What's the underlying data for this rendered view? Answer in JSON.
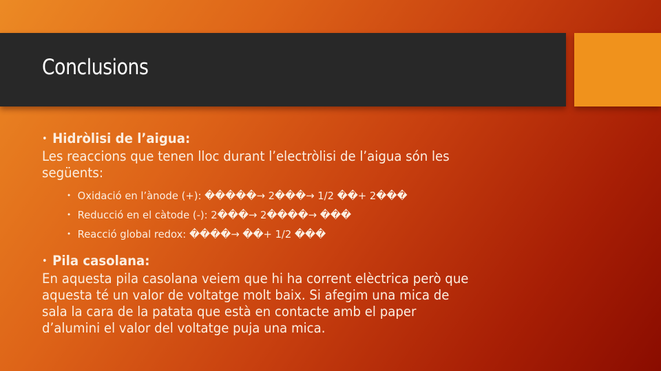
{
  "slide": {
    "title": "Conclusions",
    "colors": {
      "title_bar": "#282828",
      "accent_box": "#f0921c",
      "background_start": "#ec8a24",
      "background_end": "#8a0c00",
      "text": "#fbeee0"
    },
    "sections": [
      {
        "heading": "Hidròlisi de l’aigua:",
        "body_lines": [
          "Les reaccions que tenen lloc durant l’electròlisi de l’aigua són les",
          "següents:"
        ],
        "sub_bullets": [
          "Oxidació en l’ànode (+): �����→ 2���→ 1/2  ��+ 2���",
          "Reducció en el càtode (-): 2���→ 2����→ ���",
          "Reacció global redox: ����→ ��+ 1/2 ���"
        ]
      },
      {
        "heading": "Pila casolana:",
        "body_lines": [
          "En aquesta pila casolana veiem que hi ha corrent elèctrica però que",
          "aquesta té un valor de voltatge molt baix. Si afegim una mica de",
          "sala la cara de la patata que està en contacte amb el paper",
          "d’alumini el valor del voltatge puja una mica."
        ]
      }
    ]
  }
}
